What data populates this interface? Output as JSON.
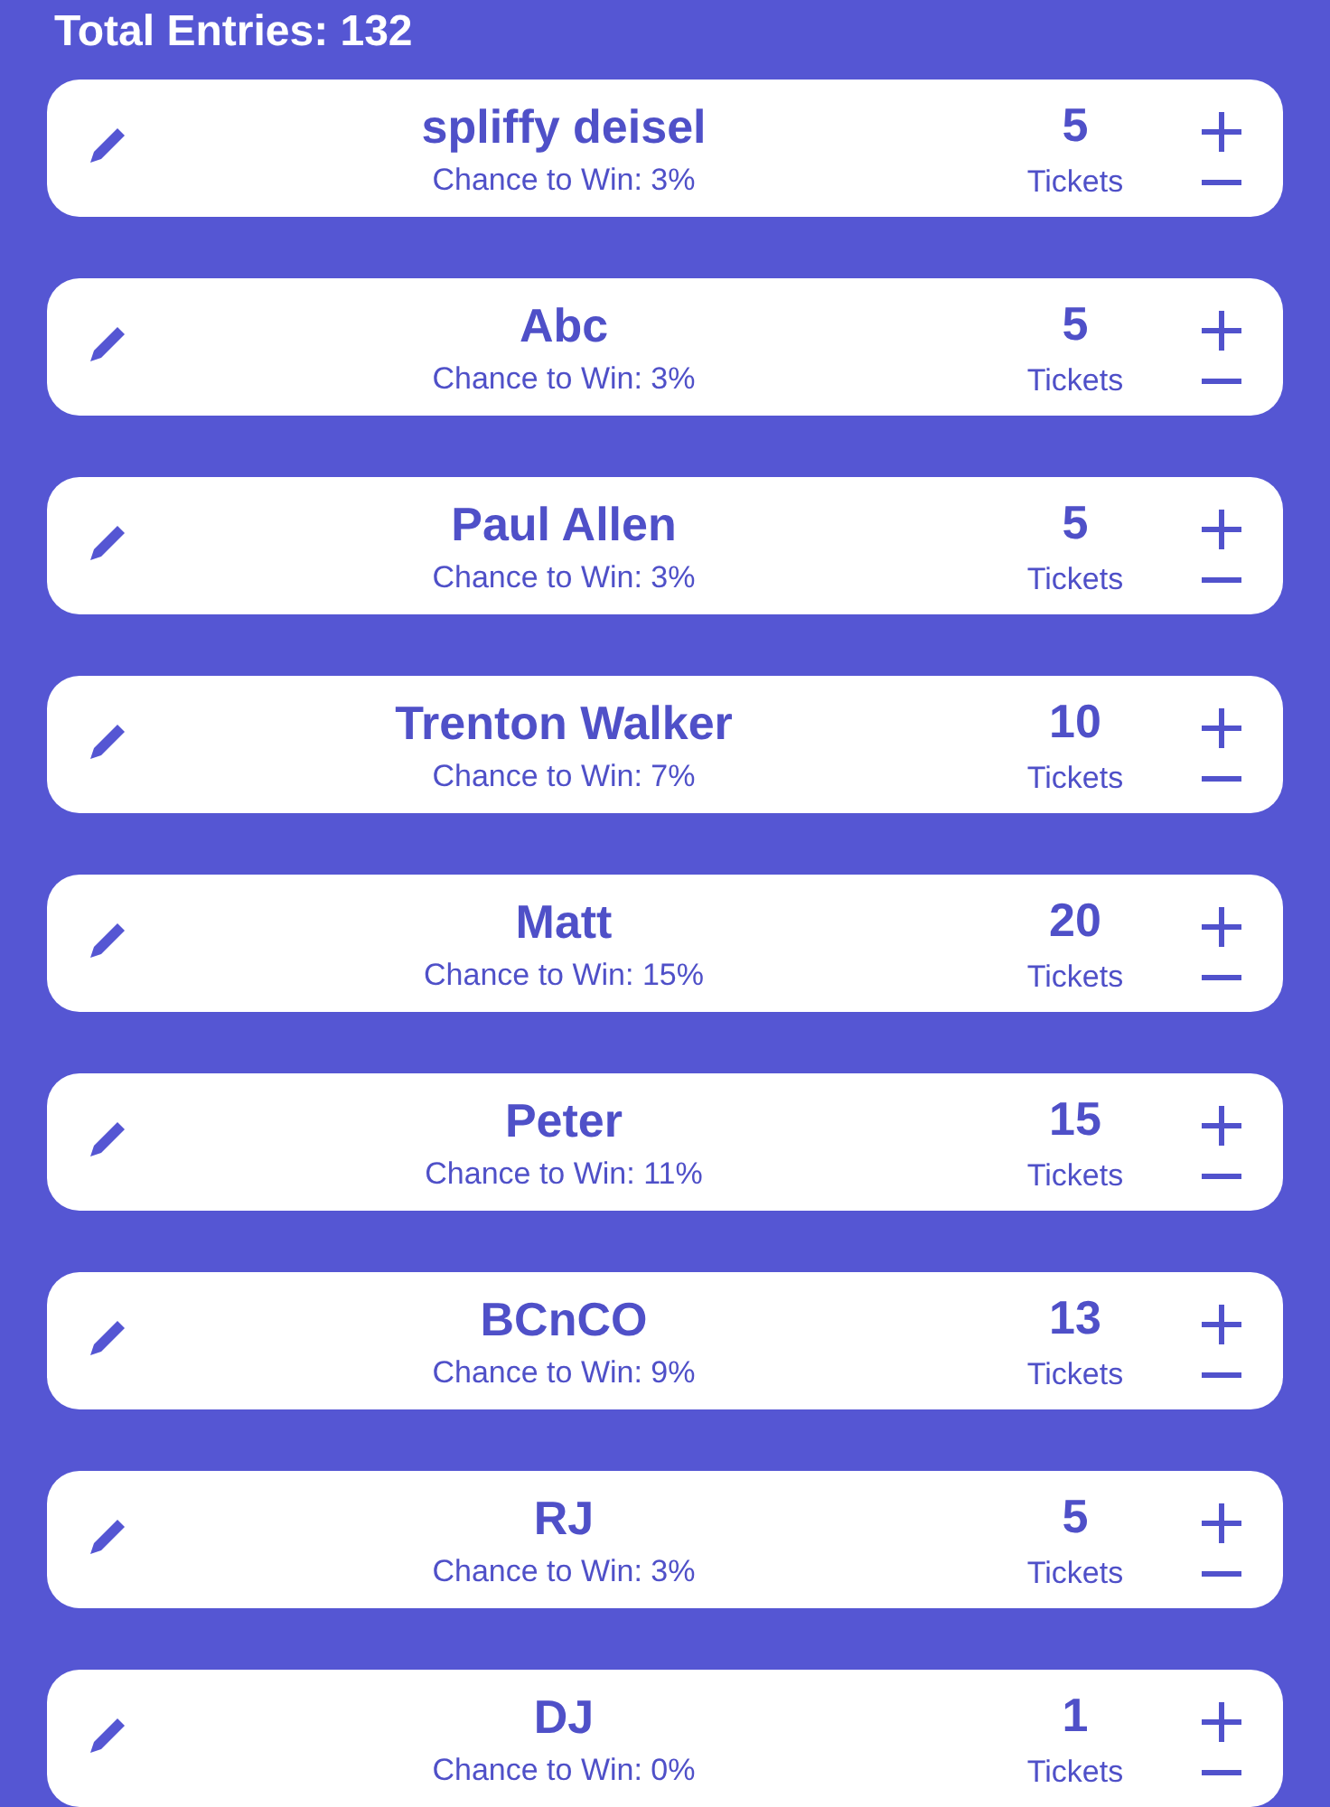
{
  "header": {
    "total": "Total Entries: 132"
  },
  "entries": [
    {
      "name": "spliffy deisel",
      "chance": "Chance to Win: 3%",
      "count": "5",
      "unit": "Tickets"
    },
    {
      "name": "Abc",
      "chance": "Chance to Win: 3%",
      "count": "5",
      "unit": "Tickets"
    },
    {
      "name": "Paul Allen",
      "chance": "Chance to Win: 3%",
      "count": "5",
      "unit": "Tickets"
    },
    {
      "name": "Trenton Walker",
      "chance": "Chance to Win: 7%",
      "count": "10",
      "unit": "Tickets"
    },
    {
      "name": "Matt",
      "chance": "Chance to Win: 15%",
      "count": "20",
      "unit": "Tickets"
    },
    {
      "name": "Peter",
      "chance": "Chance to Win: 11%",
      "count": "15",
      "unit": "Tickets"
    },
    {
      "name": "BCnCO",
      "chance": "Chance to Win: 9%",
      "count": "13",
      "unit": "Tickets"
    },
    {
      "name": "RJ",
      "chance": "Chance to Win: 3%",
      "count": "5",
      "unit": "Tickets"
    },
    {
      "name": "DJ",
      "chance": "Chance to Win: 0%",
      "count": "1",
      "unit": "Tickets"
    }
  ]
}
